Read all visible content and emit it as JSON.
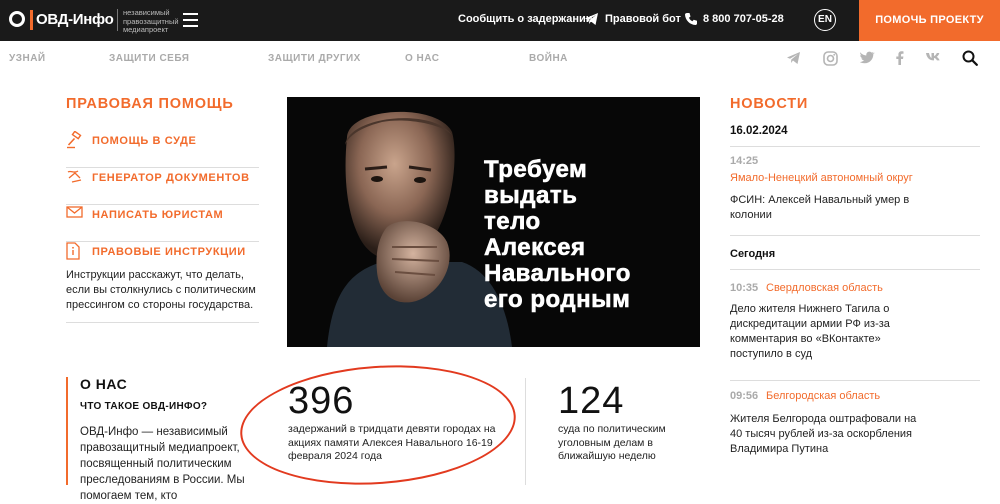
{
  "header": {
    "logo_text": "ОВД-Инфо",
    "tagline": "независимый правозащитный медиапроект",
    "report_label": "Сообщить о задержании:",
    "bot_label": "Правовой бот",
    "phone": "8 800 707-05-28",
    "lang": "EN",
    "help_button": "ПОМОЧЬ ПРОЕКТУ"
  },
  "nav": {
    "items": [
      "УЗНАЙ",
      "ЗАЩИТИ СЕБЯ",
      "ЗАЩИТИ ДРУГИХ",
      "О НАС",
      "ВОЙНА"
    ]
  },
  "social_icons": [
    "telegram-icon",
    "instagram-icon",
    "twitter-icon",
    "facebook-icon",
    "vk-icon"
  ],
  "legal": {
    "title": "ПРАВОВАЯ ПОМОЩЬ",
    "items": [
      {
        "label": "ПОМОЩЬ В СУДЕ",
        "icon": "gavel-icon"
      },
      {
        "label": "ГЕНЕРАТОР ДОКУМЕНТОВ",
        "icon": "document-generator-icon"
      },
      {
        "label": "НАПИСАТЬ ЮРИСТАМ",
        "icon": "mail-icon"
      },
      {
        "label": "ПРАВОВЫЕ ИНСТРУКЦИИ",
        "icon": "info-document-icon"
      }
    ],
    "description": "Инструкции расскажут, что делать, если вы столкнулись с политическим прессингом со стороны государства."
  },
  "hero": {
    "lines": [
      "Требуем",
      "выдать",
      "тело",
      "Алексея",
      "Навального",
      "его родным"
    ]
  },
  "news": {
    "title": "НОВОСТИ",
    "date": "16.02.2024",
    "today_label": "Сегодня",
    "items": [
      {
        "time": "14:25",
        "region": "Ямало-Ненецкий автономный округ",
        "text": "ФСИН: Алексей Навальный умер в колонии"
      },
      {
        "time": "10:35",
        "region": "Свердловская область",
        "text": "Дело жителя Нижнего Тагила о дискредитации армии РФ из-за комментария во «ВКонтакте» поступило в суд"
      },
      {
        "time": "09:56",
        "region": "Белгородская область",
        "text": "Жителя Белгорода оштрафовали на 40 тысяч рублей из-за оскорбления Владимира Путина"
      }
    ]
  },
  "about": {
    "title": "О НАС",
    "subtitle": "ЧТО ТАКОЕ ОВД-ИНФО?",
    "text": "ОВД-Инфо — независимый правозащитный медиапроект, посвященный политическим преследованиям в России. Мы помогаем тем, кто"
  },
  "stats": [
    {
      "number": "396",
      "text": "задержаний в тридцати девяти городах на акциях памяти Алексея Навального 16-19 февраля 2024 года"
    },
    {
      "number": "124",
      "text": "суда по  политическим уголовным делам в ближайшую неделю"
    }
  ],
  "colors": {
    "accent": "#f26b2c",
    "dark": "#1a1a1a",
    "annotation": "#e23a1f"
  }
}
